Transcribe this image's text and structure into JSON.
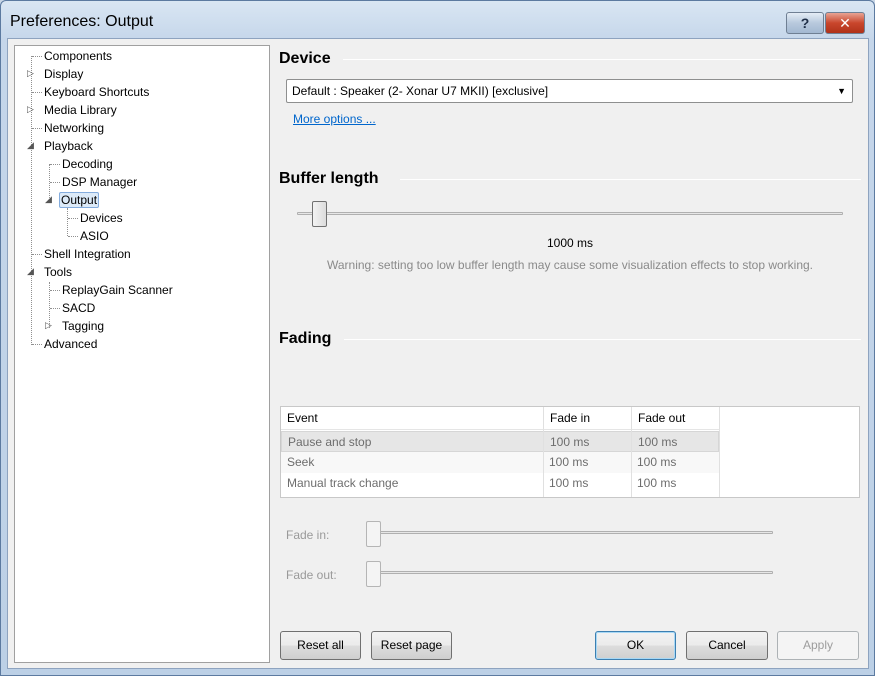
{
  "window": {
    "title": "Preferences: Output"
  },
  "titlebar": {
    "help_label": "?",
    "close_label": "✕"
  },
  "tree": {
    "items": [
      {
        "label": "Components"
      },
      {
        "label": "Display"
      },
      {
        "label": "Keyboard Shortcuts"
      },
      {
        "label": "Media Library"
      },
      {
        "label": "Networking"
      },
      {
        "label": "Playback"
      },
      {
        "label": "Decoding"
      },
      {
        "label": "DSP Manager"
      },
      {
        "label": "Output"
      },
      {
        "label": "Devices"
      },
      {
        "label": "ASIO"
      },
      {
        "label": "Shell Integration"
      },
      {
        "label": "Tools"
      },
      {
        "label": "ReplayGain Scanner"
      },
      {
        "label": "SACD"
      },
      {
        "label": "Tagging"
      },
      {
        "label": "Advanced"
      }
    ]
  },
  "device": {
    "heading": "Device",
    "selected": "Default : Speaker (2- Xonar U7 MKII) [exclusive]",
    "more_options": "More options ..."
  },
  "buffer": {
    "heading": "Buffer length",
    "value_text": "1000 ms",
    "warning": "Warning: setting too low buffer length may cause some visualization effects to stop working."
  },
  "fading": {
    "heading": "Fading",
    "columns": [
      "Event",
      "Fade in",
      "Fade out"
    ],
    "rows": [
      {
        "event": "Pause and stop",
        "fade_in": "100 ms",
        "fade_out": "100 ms"
      },
      {
        "event": "Seek",
        "fade_in": "100 ms",
        "fade_out": "100 ms"
      },
      {
        "event": "Manual track change",
        "fade_in": "100 ms",
        "fade_out": "100 ms"
      }
    ],
    "fade_in_label": "Fade in:",
    "fade_out_label": "Fade out:"
  },
  "buttons": {
    "reset_all": "Reset all",
    "reset_page": "Reset page",
    "ok": "OK",
    "cancel": "Cancel",
    "apply": "Apply"
  }
}
